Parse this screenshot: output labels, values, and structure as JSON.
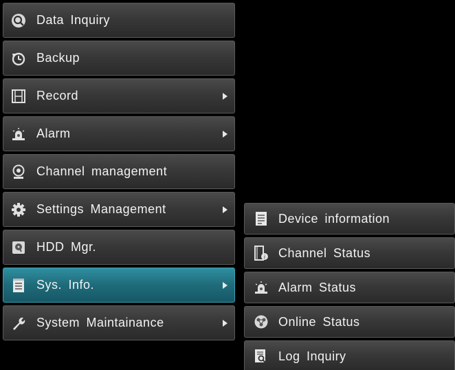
{
  "main_menu": {
    "items": [
      {
        "label": "Data Inquiry",
        "icon": "search-icon",
        "has_submenu": false,
        "active": false
      },
      {
        "label": "Backup",
        "icon": "backup-clock-icon",
        "has_submenu": false,
        "active": false
      },
      {
        "label": "Record",
        "icon": "film-icon",
        "has_submenu": true,
        "active": false
      },
      {
        "label": "Alarm",
        "icon": "alarm-siren-icon",
        "has_submenu": true,
        "active": false
      },
      {
        "label": "Channel management",
        "icon": "camera-icon",
        "has_submenu": false,
        "active": false
      },
      {
        "label": "Settings Management",
        "icon": "gear-icon",
        "has_submenu": true,
        "active": false
      },
      {
        "label": "HDD Mgr.",
        "icon": "hdd-icon",
        "has_submenu": false,
        "active": false
      },
      {
        "label": "Sys. Info.",
        "icon": "notepad-icon",
        "has_submenu": true,
        "active": true
      },
      {
        "label": "System Maintainance",
        "icon": "wrench-icon",
        "has_submenu": true,
        "active": false
      }
    ]
  },
  "submenu": {
    "items": [
      {
        "label": "Device information",
        "icon": "document-icon"
      },
      {
        "label": "Channel Status",
        "icon": "channel-info-icon"
      },
      {
        "label": "Alarm Status",
        "icon": "alarm-siren-icon"
      },
      {
        "label": "Online Status",
        "icon": "online-globe-icon"
      },
      {
        "label": "Log Inquiry",
        "icon": "log-search-icon"
      }
    ]
  },
  "colors": {
    "background": "#000000",
    "item_bg": "#3a3a3a",
    "active_bg": "#1f6b7a",
    "text": "#f2f2f2"
  }
}
